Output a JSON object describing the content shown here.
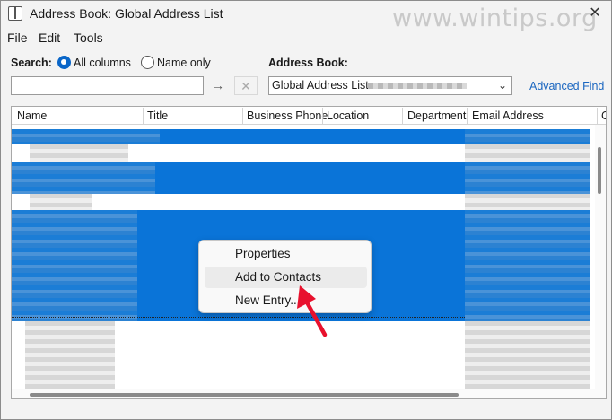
{
  "window": {
    "title": "Address Book: Global Address List",
    "watermark": "www.wintips.org",
    "close_glyph": "✕"
  },
  "menu": [
    "File",
    "Edit",
    "Tools"
  ],
  "search": {
    "label": "Search:",
    "options": [
      "All columns",
      "Name only"
    ],
    "selected_option": "All columns",
    "input_value": "",
    "go_glyph": "→",
    "clear_glyph": "✕"
  },
  "address_book": {
    "label": "Address Book:",
    "selected": "Global Address List -",
    "chevron_glyph": "⌄",
    "advanced_find": "Advanced Find"
  },
  "columns": [
    "Name",
    "Title",
    "Business Phone",
    "Location",
    "Department",
    "Email Address",
    "C"
  ],
  "context_menu": {
    "items": [
      "Properties",
      "Add to Contacts",
      "New Entry..."
    ],
    "highlighted": "Add to Contacts"
  },
  "colors": {
    "selection": "#0a74d8",
    "link": "#1a66c0",
    "arrow": "#e8112d"
  },
  "icons": {
    "app": "address-book-icon",
    "pointer": "red-arrow-icon"
  }
}
